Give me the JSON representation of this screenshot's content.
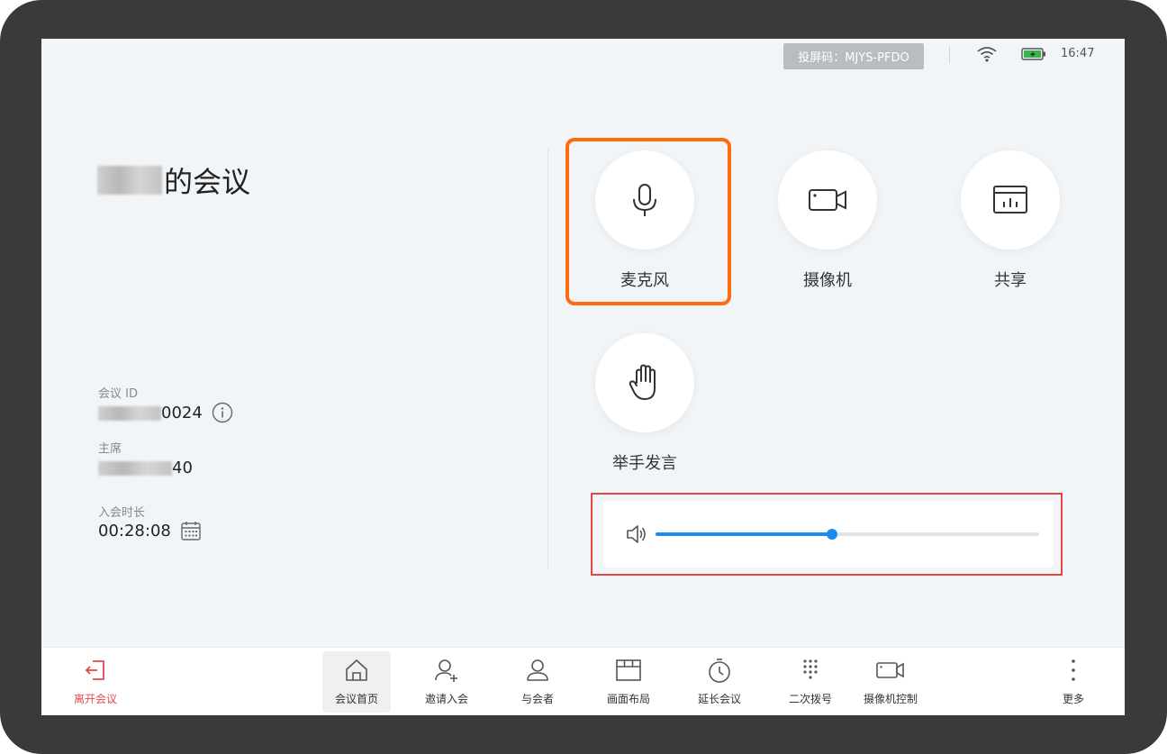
{
  "status_bar": {
    "cast_code": "投屏码：MJYS-PFDO",
    "time": "16:47"
  },
  "meeting": {
    "title_suffix": "的会议",
    "id_label": "会议 ID",
    "id_value_visible": "0024",
    "host_label": "主席",
    "host_value_visible": "40",
    "duration_label": "入会时长",
    "duration_value": "00:28:08"
  },
  "controls": {
    "microphone": "麦克风",
    "camera": "摄像机",
    "share": "共享",
    "raise_hand": "举手发言"
  },
  "volume": {
    "level": 0.46
  },
  "toolbar": {
    "leave": "离开会议",
    "home": "会议首页",
    "invite": "邀请入会",
    "participants": "与会者",
    "layout": "画面布局",
    "extend": "延长会议",
    "dialpad": "二次拨号",
    "camera_control": "摄像机控制",
    "more": "更多"
  },
  "colors": {
    "accent": "#1a8cf0",
    "highlight": "#ff6a0d",
    "leave": "#e04b4b"
  }
}
